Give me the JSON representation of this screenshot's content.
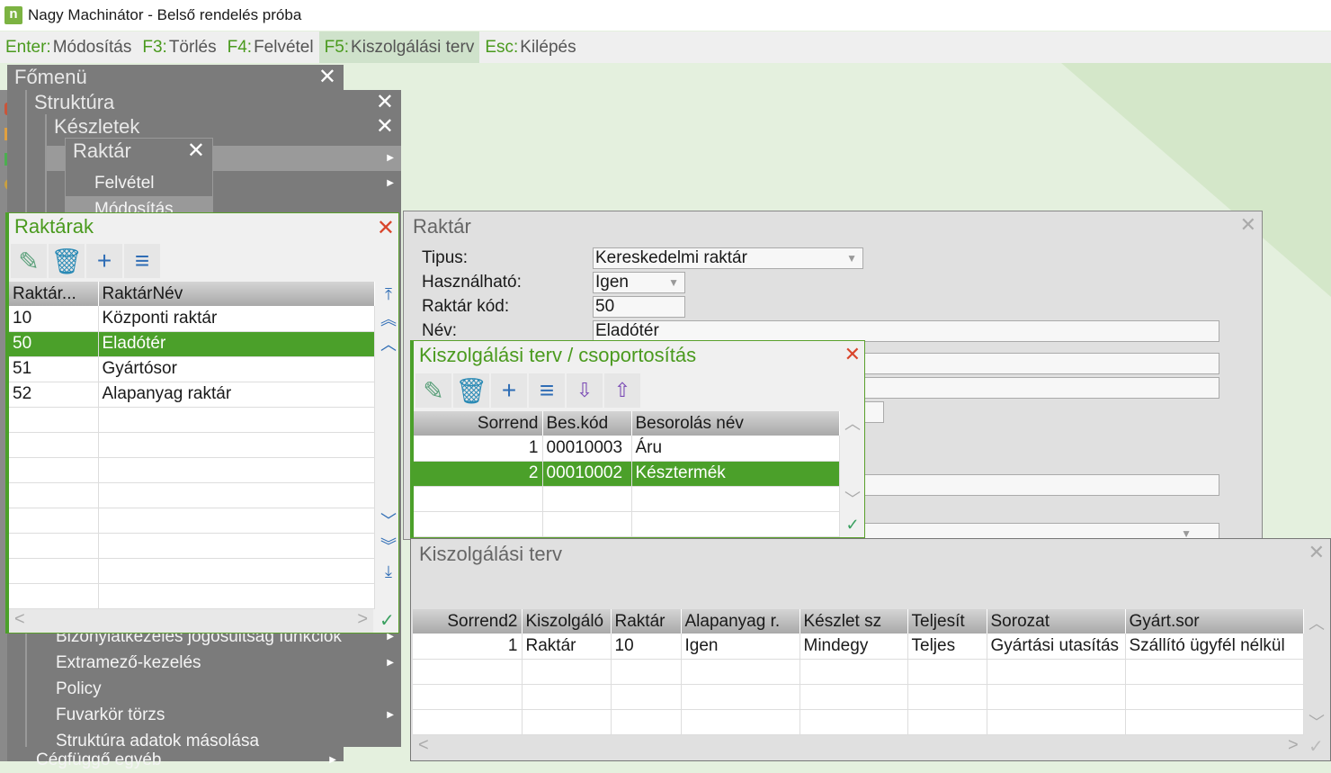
{
  "app": {
    "title": "Nagy Machinátor - Belső rendelés próba",
    "logo": "n"
  },
  "fnbar": [
    {
      "key": "Enter:",
      "label": "Módosítás"
    },
    {
      "key": "F3:",
      "label": "Törlés"
    },
    {
      "key": "F4:",
      "label": "Felvétel"
    },
    {
      "key": "F5:",
      "label": "Kiszolgálási terv",
      "active": true
    },
    {
      "key": "Esc:",
      "label": "Kilépés"
    }
  ],
  "menus": {
    "main": "Főmenü",
    "struktura": "Struktúra",
    "keszletek": "Készletek",
    "raktar": "Raktár",
    "raktar_items": [
      "Felvétel",
      "Módosítás"
    ],
    "struktura_items": [
      "Bizonylatkezelés jogosultság funkciók",
      "Extramező-kezelés",
      "Policy",
      "Fuvarkör törzs",
      "Struktúra adatok másolása"
    ],
    "main_items": [
      "Cégfüggő egyéb"
    ]
  },
  "raktarak": {
    "title": "Raktárak",
    "columns": [
      "Raktár...",
      "RaktárNév"
    ],
    "rows": [
      [
        "10",
        "Központi raktár"
      ],
      [
        "50",
        "Eladótér"
      ],
      [
        "51",
        "Gyártósor"
      ],
      [
        "52",
        "Alapanyag raktár"
      ]
    ],
    "selected": 1,
    "empty_rows": 8
  },
  "form": {
    "title": "Raktár",
    "fields": [
      {
        "label": "Tipus:",
        "value": "Kereskedelmi raktár"
      },
      {
        "label": "Használható:",
        "value": "Igen"
      },
      {
        "label": "Raktár kód:",
        "value": "50"
      },
      {
        "label": "Név:",
        "value": "Eladótér"
      }
    ]
  },
  "csoport": {
    "title": "Kiszolgálási terv / csoportosítás",
    "columns": [
      "Sorrend",
      "Bes.kód",
      "Besorolás név"
    ],
    "rows": [
      [
        "1",
        "00010003",
        "Áru"
      ],
      [
        "2",
        "00010002",
        "Késztermék"
      ]
    ],
    "selected": 1,
    "empty_rows": 2
  },
  "terv": {
    "title": "Kiszolgálási terv",
    "columns": [
      "Sorrend2",
      "Kiszolgáló",
      "Raktár",
      "Alapanyag r.",
      "Készlet sz",
      "Teljesít",
      "Sorozat",
      "Gyárt.sor"
    ],
    "rows": [
      [
        "1",
        "Raktár",
        "10",
        "Igen",
        "Mindegy",
        "Teljes",
        "Gyártási utasítás",
        "Szállító ügyfél nélkül"
      ]
    ],
    "empty_rows": 3
  },
  "colors": {
    "accent": "#4ba02a",
    "close_red": "#d9452b",
    "bg": "#e4f0de"
  }
}
